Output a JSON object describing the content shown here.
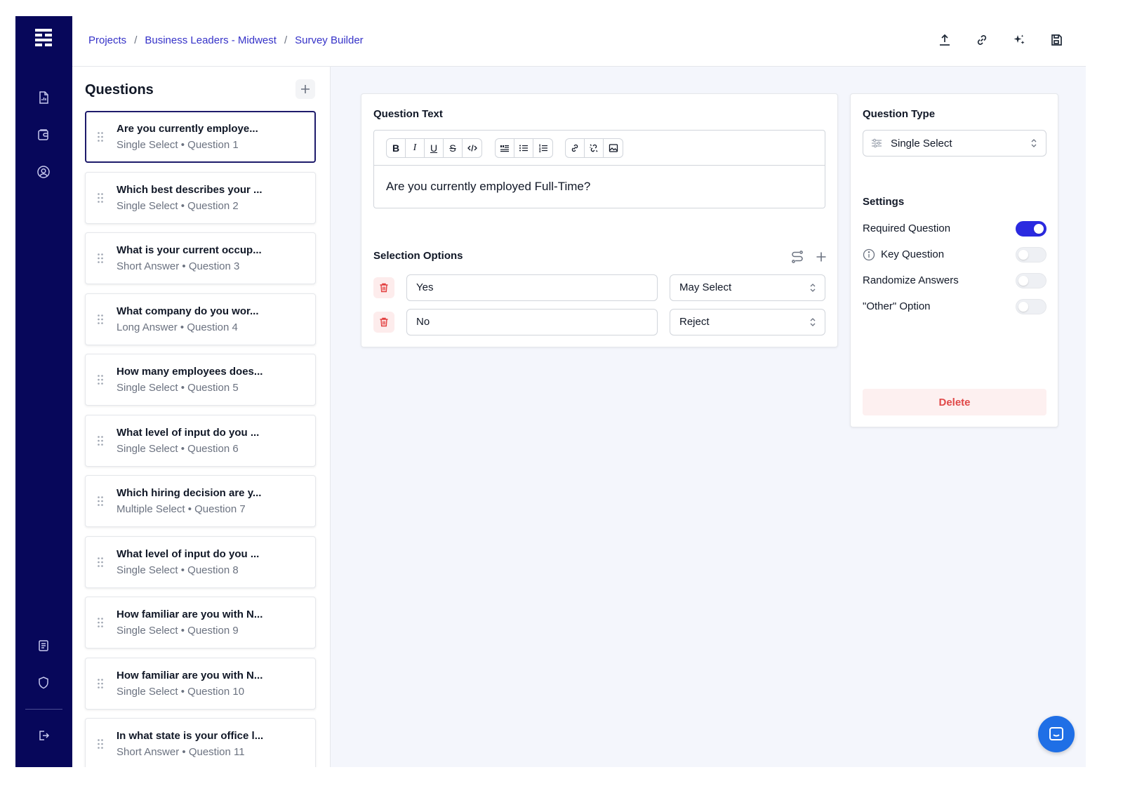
{
  "breadcrumb": [
    {
      "label": "Projects"
    },
    {
      "label": "Business Leaders - Midwest"
    },
    {
      "label": "Survey Builder"
    }
  ],
  "breadcrumb_separator": "/",
  "header_actions": [
    "upload-icon",
    "link-icon",
    "sparkles-icon",
    "save-icon"
  ],
  "rail_icons": [
    "report-icon",
    "wallet-icon",
    "user-circle-icon",
    "document-list-icon",
    "shield-icon",
    "logout-icon"
  ],
  "questions_panel": {
    "title": "Questions",
    "add_label": "+",
    "items": [
      {
        "title": "Are you currently employe...",
        "type": "Single Select",
        "number": "Question 1",
        "active": true
      },
      {
        "title": "Which best describes your ...",
        "type": "Single Select",
        "number": "Question 2"
      },
      {
        "title": "What is your current occup...",
        "type": "Short Answer",
        "number": "Question 3"
      },
      {
        "title": "What company do you wor...",
        "type": "Long Answer",
        "number": "Question 4"
      },
      {
        "title": "How many employees does...",
        "type": "Single Select",
        "number": "Question 5"
      },
      {
        "title": "What level of input do you ...",
        "type": "Single Select",
        "number": "Question 6"
      },
      {
        "title": "Which hiring decision are y...",
        "type": "Multiple Select",
        "number": "Question 7"
      },
      {
        "title": "What level of input do you ...",
        "type": "Single Select",
        "number": "Question 8"
      },
      {
        "title": "How familiar are you with N...",
        "type": "Single Select",
        "number": "Question 9"
      },
      {
        "title": "How familiar are you with N...",
        "type": "Single Select",
        "number": "Question 10"
      },
      {
        "title": "In what state is your office l...",
        "type": "Short Answer",
        "number": "Question 11"
      }
    ]
  },
  "editor": {
    "question_text_label": "Question Text",
    "question_text": "Are you currently employed Full-Time?",
    "toolbar": {
      "bold": "B",
      "italic": "I",
      "underline": "U",
      "strike": "S"
    },
    "selection_options_label": "Selection Options",
    "options": [
      {
        "value": "Yes",
        "rule": "May Select"
      },
      {
        "value": "No",
        "rule": "Reject"
      }
    ]
  },
  "settings_card": {
    "question_type_label": "Question Type",
    "question_type_value": "Single Select",
    "settings_label": "Settings",
    "settings": [
      {
        "label": "Required Question",
        "on": true
      },
      {
        "label": "Key Question",
        "on": false
      },
      {
        "label": "Randomize Answers",
        "on": false
      },
      {
        "label": "\"Other\" Option",
        "on": false
      }
    ],
    "delete_label": "Delete"
  },
  "colors": {
    "rail": "#07075a",
    "accent": "#2b2ae0",
    "link": "#3532c8",
    "danger": "#e04848",
    "chat": "#1f6fe6"
  }
}
